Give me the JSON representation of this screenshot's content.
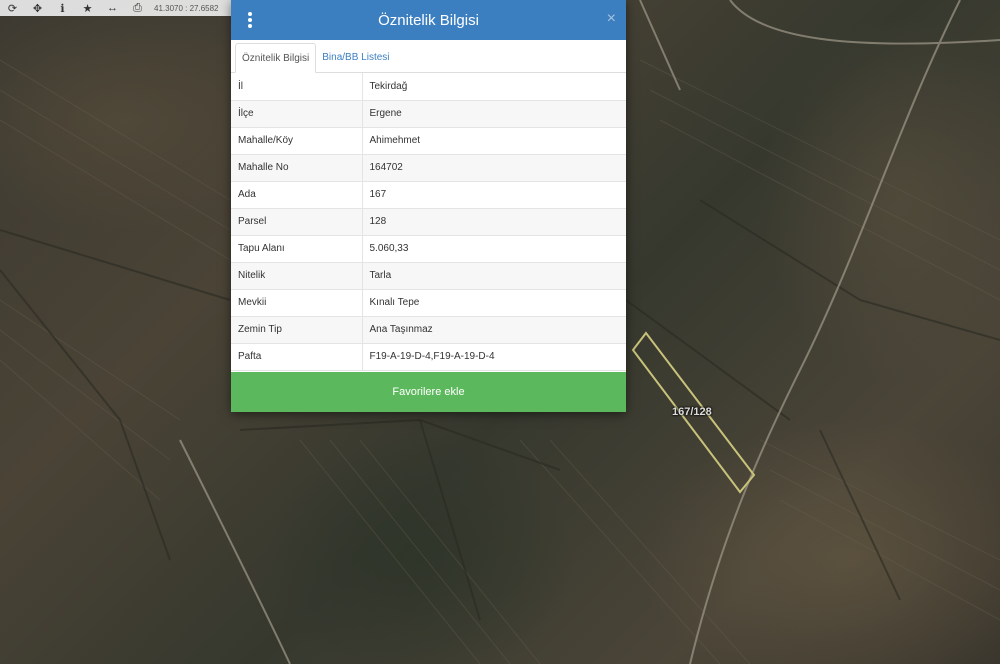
{
  "toolbar": {
    "icons": [
      "refresh-icon",
      "crosshair-icon",
      "info-icon",
      "star-icon",
      "measure-icon",
      "print-icon"
    ],
    "coordinates": "41.3070 : 27.6582"
  },
  "map": {
    "parcel_label": "167/128",
    "parcel_outline_color": "#c8c27a"
  },
  "dialog": {
    "title": "Öznitelik Bilgisi",
    "header_color": "#3c7fc1",
    "tabs": [
      {
        "label": "Öznitelik Bilgisi",
        "active": true
      },
      {
        "label": "Bina/BB Listesi",
        "active": false
      }
    ],
    "rows": [
      {
        "key": "İl",
        "value": "Tekirdağ"
      },
      {
        "key": "İlçe",
        "value": "Ergene"
      },
      {
        "key": "Mahalle/Köy",
        "value": "Ahimehmet"
      },
      {
        "key": "Mahalle No",
        "value": "164702"
      },
      {
        "key": "Ada",
        "value": "167"
      },
      {
        "key": "Parsel",
        "value": "128"
      },
      {
        "key": "Tapu Alanı",
        "value": "5.060,33"
      },
      {
        "key": "Nitelik",
        "value": "Tarla"
      },
      {
        "key": "Mevkii",
        "value": "Kınalı Tepe"
      },
      {
        "key": "Zemin Tip",
        "value": "Ana Taşınmaz"
      },
      {
        "key": "Pafta",
        "value": "F19-A-19-D-4,F19-A-19-D-4"
      }
    ],
    "favorite_button": "Favorilere ekle",
    "button_color": "#5cb85c"
  }
}
